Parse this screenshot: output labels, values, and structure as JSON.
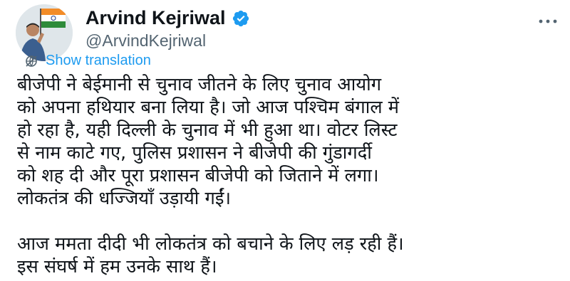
{
  "author": {
    "name": "Arvind Kejriwal",
    "handle": "@ArvindKejriwal"
  },
  "icons": {
    "verified": "verified-badge-icon",
    "more": "more-options-icon",
    "translate": "globe-icon"
  },
  "colors": {
    "verified": "#1d9bf0",
    "link": "#1d9bf0",
    "handle": "#536471",
    "text": "#0f1419"
  },
  "translate_label": "Show translation",
  "tweet": {
    "paragraph1": [
      "बीजेपी ने बेईमानी से चुनाव जीतने के लिए चुनाव आयोग",
      "को अपना हथियार बना लिया है। जो आज पश्चिम बंगाल में",
      "हो रहा है, यही दिल्ली के चुनाव में भी हुआ था। वोटर लिस्ट",
      "से नाम काटे गए, पुलिस प्रशासन ने बीजेपी की गुंडागर्दी",
      "को शह दी और पूरा प्रशासन बीजेपी को जिताने में लगा।",
      "लोकतंत्र की धज्जियाँ उड़ायी गईं।"
    ],
    "paragraph2": [
      "आज ममता दीदी भी लोकतंत्र को बचाने के लिए लड़ रही हैं।",
      "इस संघर्ष में हम उनके साथ हैं।"
    ]
  }
}
